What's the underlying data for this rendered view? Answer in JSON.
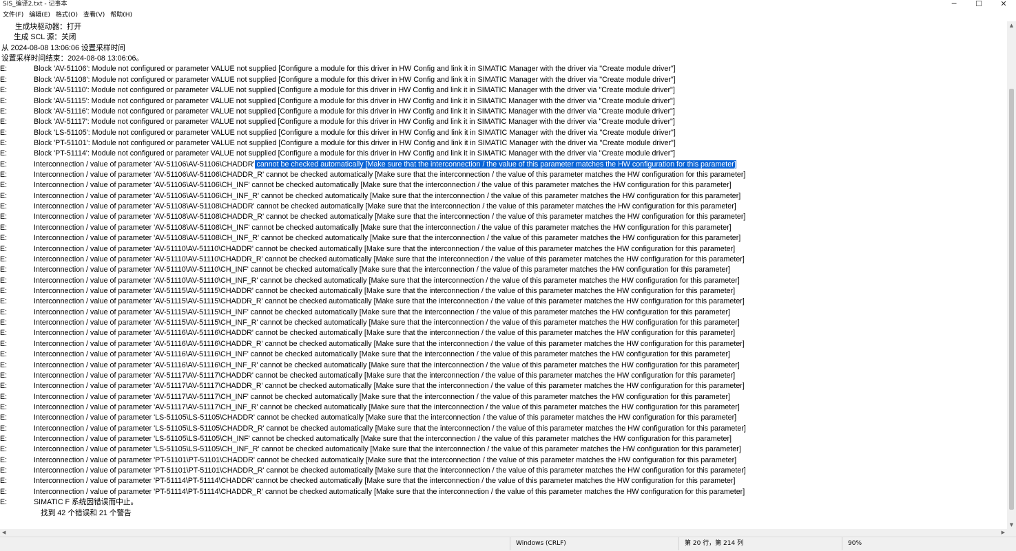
{
  "window": {
    "title": "SIS_编译2.txt - 记事本",
    "minimize": "─",
    "maximize": "☐",
    "close": "✕"
  },
  "menu": [
    "文件(F)",
    "编辑(E)",
    "格式(O)",
    "查看(V)",
    "帮助(H)"
  ],
  "header_lines": [
    {
      "text": "生成块驱动器：打开",
      "indent": "i1"
    },
    {
      "text": "生成 SCL 源：关闭",
      "indent": "i2"
    },
    {
      "text": "从 2024-08-08 13:06:06 设置采样时间",
      "indent": "i0"
    },
    {
      "text": "设置采样时间结束：2024-08-08 13:06:06。",
      "indent": "i0"
    }
  ],
  "error_prefix": "E:",
  "log_lines": [
    {
      "text": "Block 'AV-51106': Module not configured or parameter VALUE not supplied [Configure a module for this driver in HW Config and link it in SIMATIC Manager with the driver via \"Create module driver\"]"
    },
    {
      "text": "Block 'AV-51108': Module not configured or parameter VALUE not supplied [Configure a module for this driver in HW Config and link it in SIMATIC Manager with the driver via \"Create module driver\"]"
    },
    {
      "text": "Block 'AV-51110': Module not configured or parameter VALUE not supplied [Configure a module for this driver in HW Config and link it in SIMATIC Manager with the driver via \"Create module driver\"]"
    },
    {
      "text": "Block 'AV-51115': Module not configured or parameter VALUE not supplied [Configure a module for this driver in HW Config and link it in SIMATIC Manager with the driver via \"Create module driver\"]"
    },
    {
      "text": "Block 'AV-51116': Module not configured or parameter VALUE not supplied [Configure a module for this driver in HW Config and link it in SIMATIC Manager with the driver via \"Create module driver\"]"
    },
    {
      "text": "Block 'AV-51117': Module not configured or parameter VALUE not supplied [Configure a module for this driver in HW Config and link it in SIMATIC Manager with the driver via \"Create module driver\"]"
    },
    {
      "text": "Block 'LS-51105': Module not configured or parameter VALUE not supplied [Configure a module for this driver in HW Config and link it in SIMATIC Manager with the driver via \"Create module driver\"]"
    },
    {
      "text": "Block 'PT-51101': Module not configured or parameter VALUE not supplied [Configure a module for this driver in HW Config and link it in SIMATIC Manager with the driver via \"Create module driver\"]"
    },
    {
      "text": "Block 'PT-51114': Module not configured or parameter VALUE not supplied [Configure a module for this driver in HW Config and link it in SIMATIC Manager with the driver via \"Create module driver\"]"
    },
    {
      "text": "Interconnection / value of parameter 'AV-51106\\AV-51106\\CHADDR'",
      "selected": " cannot be checked automatically [Make sure that the interconnection / the value of this parameter matches the HW configuration for this parameter]"
    },
    {
      "text": "Interconnection / value of parameter 'AV-51106\\AV-51106\\CHADDR_R' cannot be checked automatically [Make sure that the interconnection / the value of this parameter matches the HW configuration for this parameter]"
    },
    {
      "text": "Interconnection / value of parameter 'AV-51106\\AV-51106\\CH_INF' cannot be checked automatically [Make sure that the interconnection / the value of this parameter matches the HW configuration for this parameter]"
    },
    {
      "text": "Interconnection / value of parameter 'AV-51106\\AV-51106\\CH_INF_R' cannot be checked automatically [Make sure that the interconnection / the value of this parameter matches the HW configuration for this parameter]"
    },
    {
      "text": "Interconnection / value of parameter 'AV-51108\\AV-51108\\CHADDR' cannot be checked automatically [Make sure that the interconnection / the value of this parameter matches the HW configuration for this parameter]"
    },
    {
      "text": "Interconnection / value of parameter 'AV-51108\\AV-51108\\CHADDR_R' cannot be checked automatically [Make sure that the interconnection / the value of this parameter matches the HW configuration for this parameter]"
    },
    {
      "text": "Interconnection / value of parameter 'AV-51108\\AV-51108\\CH_INF' cannot be checked automatically [Make sure that the interconnection / the value of this parameter matches the HW configuration for this parameter]"
    },
    {
      "text": "Interconnection / value of parameter 'AV-51108\\AV-51108\\CH_INF_R' cannot be checked automatically [Make sure that the interconnection / the value of this parameter matches the HW configuration for this parameter]"
    },
    {
      "text": "Interconnection / value of parameter 'AV-51110\\AV-51110\\CHADDR' cannot be checked automatically [Make sure that the interconnection / the value of this parameter matches the HW configuration for this parameter]"
    },
    {
      "text": "Interconnection / value of parameter 'AV-51110\\AV-51110\\CHADDR_R' cannot be checked automatically [Make sure that the interconnection / the value of this parameter matches the HW configuration for this parameter]"
    },
    {
      "text": "Interconnection / value of parameter 'AV-51110\\AV-51110\\CH_INF' cannot be checked automatically [Make sure that the interconnection / the value of this parameter matches the HW configuration for this parameter]"
    },
    {
      "text": "Interconnection / value of parameter 'AV-51110\\AV-51110\\CH_INF_R' cannot be checked automatically [Make sure that the interconnection / the value of this parameter matches the HW configuration for this parameter]"
    },
    {
      "text": "Interconnection / value of parameter 'AV-51115\\AV-51115\\CHADDR' cannot be checked automatically [Make sure that the interconnection / the value of this parameter matches the HW configuration for this parameter]"
    },
    {
      "text": "Interconnection / value of parameter 'AV-51115\\AV-51115\\CHADDR_R' cannot be checked automatically [Make sure that the interconnection / the value of this parameter matches the HW configuration for this parameter]"
    },
    {
      "text": "Interconnection / value of parameter 'AV-51115\\AV-51115\\CH_INF' cannot be checked automatically [Make sure that the interconnection / the value of this parameter matches the HW configuration for this parameter]"
    },
    {
      "text": "Interconnection / value of parameter 'AV-51115\\AV-51115\\CH_INF_R' cannot be checked automatically [Make sure that the interconnection / the value of this parameter matches the HW configuration for this parameter]"
    },
    {
      "text": "Interconnection / value of parameter 'AV-51116\\AV-51116\\CHADDR' cannot be checked automatically [Make sure that the interconnection / the value of this parameter matches the HW configuration for this parameter]"
    },
    {
      "text": "Interconnection / value of parameter 'AV-51116\\AV-51116\\CHADDR_R' cannot be checked automatically [Make sure that the interconnection / the value of this parameter matches the HW configuration for this parameter]"
    },
    {
      "text": "Interconnection / value of parameter 'AV-51116\\AV-51116\\CH_INF' cannot be checked automatically [Make sure that the interconnection / the value of this parameter matches the HW configuration for this parameter]"
    },
    {
      "text": "Interconnection / value of parameter 'AV-51116\\AV-51116\\CH_INF_R' cannot be checked automatically [Make sure that the interconnection / the value of this parameter matches the HW configuration for this parameter]"
    },
    {
      "text": "Interconnection / value of parameter 'AV-51117\\AV-51117\\CHADDR' cannot be checked automatically [Make sure that the interconnection / the value of this parameter matches the HW configuration for this parameter]"
    },
    {
      "text": "Interconnection / value of parameter 'AV-51117\\AV-51117\\CHADDR_R' cannot be checked automatically [Make sure that the interconnection / the value of this parameter matches the HW configuration for this parameter]"
    },
    {
      "text": "Interconnection / value of parameter 'AV-51117\\AV-51117\\CH_INF' cannot be checked automatically [Make sure that the interconnection / the value of this parameter matches the HW configuration for this parameter]"
    },
    {
      "text": "Interconnection / value of parameter 'AV-51117\\AV-51117\\CH_INF_R' cannot be checked automatically [Make sure that the interconnection / the value of this parameter matches the HW configuration for this parameter]"
    },
    {
      "text": "Interconnection / value of parameter 'LS-51105\\LS-51105\\CHADDR' cannot be checked automatically [Make sure that the interconnection / the value of this parameter matches the HW configuration for this parameter]"
    },
    {
      "text": "Interconnection / value of parameter 'LS-51105\\LS-51105\\CHADDR_R' cannot be checked automatically [Make sure that the interconnection / the value of this parameter matches the HW configuration for this parameter]"
    },
    {
      "text": "Interconnection / value of parameter 'LS-51105\\LS-51105\\CH_INF' cannot be checked automatically [Make sure that the interconnection / the value of this parameter matches the HW configuration for this parameter]"
    },
    {
      "text": "Interconnection / value of parameter 'LS-51105\\LS-51105\\CH_INF_R' cannot be checked automatically [Make sure that the interconnection / the value of this parameter matches the HW configuration for this parameter]"
    },
    {
      "text": "Interconnection / value of parameter 'PT-51101\\PT-51101\\CHADDR' cannot be checked automatically [Make sure that the interconnection / the value of this parameter matches the HW configuration for this parameter]"
    },
    {
      "text": "Interconnection / value of parameter 'PT-51101\\PT-51101\\CHADDR_R' cannot be checked automatically [Make sure that the interconnection / the value of this parameter matches the HW configuration for this parameter]"
    },
    {
      "text": "Interconnection / value of parameter 'PT-51114\\PT-51114\\CHADDR' cannot be checked automatically [Make sure that the interconnection / the value of this parameter matches the HW configuration for this parameter]"
    },
    {
      "text": "Interconnection / value of parameter 'PT-51114\\PT-51114\\CHADDR_R' cannot be checked automatically [Make sure that the interconnection / the value of this parameter matches the HW configuration for this parameter]"
    },
    {
      "text": "SIMATIC F 系统因错误而中止。"
    }
  ],
  "summary": "找到 42 个错误和 21 个警告",
  "statusbar": {
    "line_ending": "Windows (CRLF)",
    "position": "第 20 行，第 214 列",
    "zoom": "90%"
  },
  "colors": {
    "selection": "#0a64d6",
    "statusbar_bg": "#f0f0f0"
  }
}
